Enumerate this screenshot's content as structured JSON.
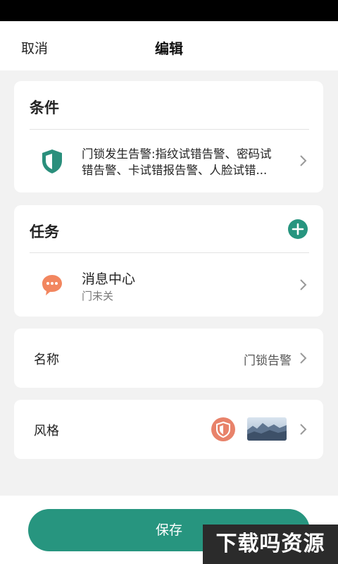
{
  "header": {
    "cancel_label": "取消",
    "title": "编辑"
  },
  "condition": {
    "section_title": "条件",
    "icon": "shield-icon",
    "description_line1": "门锁发生告警:指纹试错告警、密码试",
    "description_line2": "错告警、卡试错报告警、人脸试错..."
  },
  "task": {
    "section_title": "任务",
    "add_icon": "plus-circle-icon",
    "item": {
      "icon": "chat-bubble-icon",
      "name": "消息中心",
      "subtitle": "门未关"
    }
  },
  "name_row": {
    "label": "名称",
    "value": "门锁告警"
  },
  "style_row": {
    "label": "风格",
    "icon": "shield-badge-icon",
    "thumbnail": "landscape-thumbnail"
  },
  "save_label": "保存",
  "watermark": "下载吗资源",
  "colors": {
    "accent": "#27957f",
    "shield": "#2a8f7c",
    "chat": "#f2865f",
    "badge": "#e8826a"
  }
}
